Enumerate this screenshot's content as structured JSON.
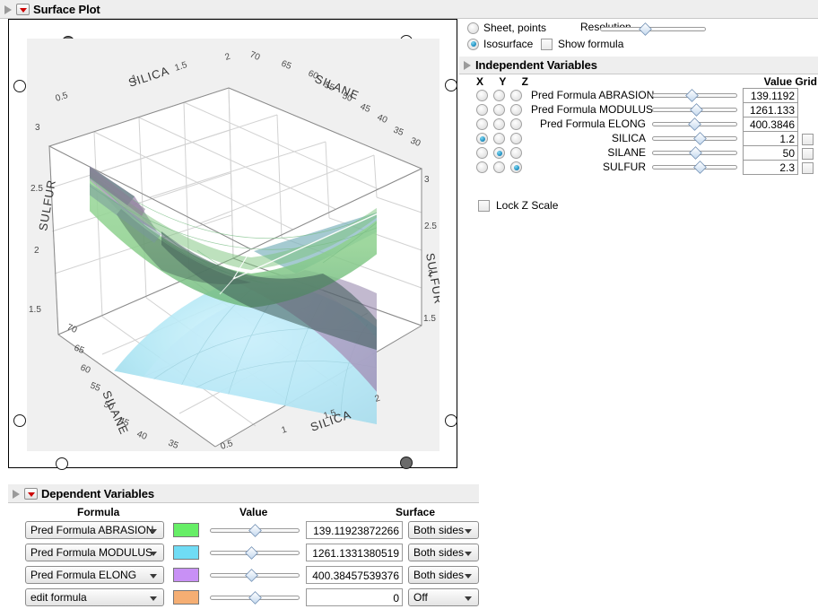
{
  "window": {
    "surface_plot_title": "Surface Plot",
    "dependent_title": "Dependent Variables",
    "independent_title": "Independent Variables"
  },
  "display_mode": {
    "option_sheet_points": "Sheet, points",
    "option_isosurface": "Isosurface",
    "selected": "Isosurface",
    "resolution_label": "Resolution",
    "show_formula_label": "Show formula",
    "show_formula_checked": false,
    "resolution_value_pct": 42
  },
  "independent": {
    "axis_headers": [
      "X",
      "Y",
      "Z"
    ],
    "value_header": "Value",
    "grid_header": "Grid",
    "value_grid_header": "Value Grid",
    "lock_z_label": "Lock Z Scale",
    "lock_z_checked": false,
    "rows": [
      {
        "name": "Pred Formula ABRASION",
        "value": "139.1192",
        "x": false,
        "y": false,
        "z": false,
        "has_grid": false,
        "slider_pct": 46
      },
      {
        "name": "Pred Formula MODULUS",
        "value": "1261.133",
        "x": false,
        "y": false,
        "z": false,
        "has_grid": false,
        "slider_pct": 52
      },
      {
        "name": "Pred Formula ELONG",
        "value": "400.3846",
        "x": false,
        "y": false,
        "z": false,
        "has_grid": false,
        "slider_pct": 49
      },
      {
        "name": "SILICA",
        "value": "1.2",
        "x": true,
        "y": false,
        "z": false,
        "has_grid": true,
        "grid_checked": false,
        "slider_pct": 56
      },
      {
        "name": "SILANE",
        "value": "50",
        "x": false,
        "y": true,
        "z": false,
        "has_grid": true,
        "grid_checked": false,
        "slider_pct": 50
      },
      {
        "name": "SULFUR",
        "value": "2.3",
        "x": false,
        "y": false,
        "z": true,
        "has_grid": true,
        "grid_checked": false,
        "slider_pct": 56
      }
    ]
  },
  "dependent": {
    "headers": {
      "formula": "Formula",
      "value": "Value",
      "surface": "Surface"
    },
    "rows": [
      {
        "formula": "Pred Formula ABRASION",
        "color": "#66ee66",
        "value": "139.11923872266",
        "surface": "Both sides",
        "slider_pct": 50
      },
      {
        "formula": "Pred Formula MODULUS",
        "color": "#6fdcf5",
        "value": "1261.1331380519",
        "surface": "Both sides",
        "slider_pct": 46
      },
      {
        "formula": "Pred Formula ELONG",
        "color": "#c890f5",
        "value": "400.38457539376",
        "surface": "Both sides",
        "slider_pct": 46
      },
      {
        "formula": "edit formula",
        "color": "#f5ae73",
        "value": "0",
        "surface": "Off",
        "slider_pct": 50
      }
    ]
  },
  "chart_data": {
    "type": "surface",
    "title": "Surface Plot",
    "axes": {
      "x": {
        "label": "SILICA",
        "ticks": [
          "0.5",
          "1",
          "1.5",
          "2"
        ],
        "range": [
          0.3,
          2.2
        ]
      },
      "y": {
        "label": "SILANE",
        "ticks": [
          "30",
          "35",
          "40",
          "45",
          "50",
          "55",
          "60",
          "65",
          "70"
        ],
        "range": [
          28,
          72
        ]
      },
      "z": {
        "label": "SULFUR",
        "ticks": [
          "1.5",
          "2",
          "2.5",
          "3"
        ],
        "range": [
          1.3,
          3.2
        ]
      }
    },
    "surfaces": [
      {
        "name": "Pred Formula ABRASION",
        "color": "#66ee66",
        "isovalue": 139.11923872266,
        "surface_mode": "Both sides"
      },
      {
        "name": "Pred Formula MODULUS",
        "color": "#6fdcf5",
        "isovalue": 1261.1331380519,
        "surface_mode": "Both sides"
      },
      {
        "name": "Pred Formula ELONG",
        "color": "#c890f5",
        "isovalue": 400.38457539376,
        "surface_mode": "Both sides"
      }
    ],
    "axis_label_top_left": "SILICA",
    "axis_label_top_right": "SILANE",
    "axis_label_left": "SULFUR",
    "axis_label_right": "SULFUR",
    "axis_label_bottom_left": "SILANE",
    "axis_label_bottom_right": "SILICA"
  }
}
